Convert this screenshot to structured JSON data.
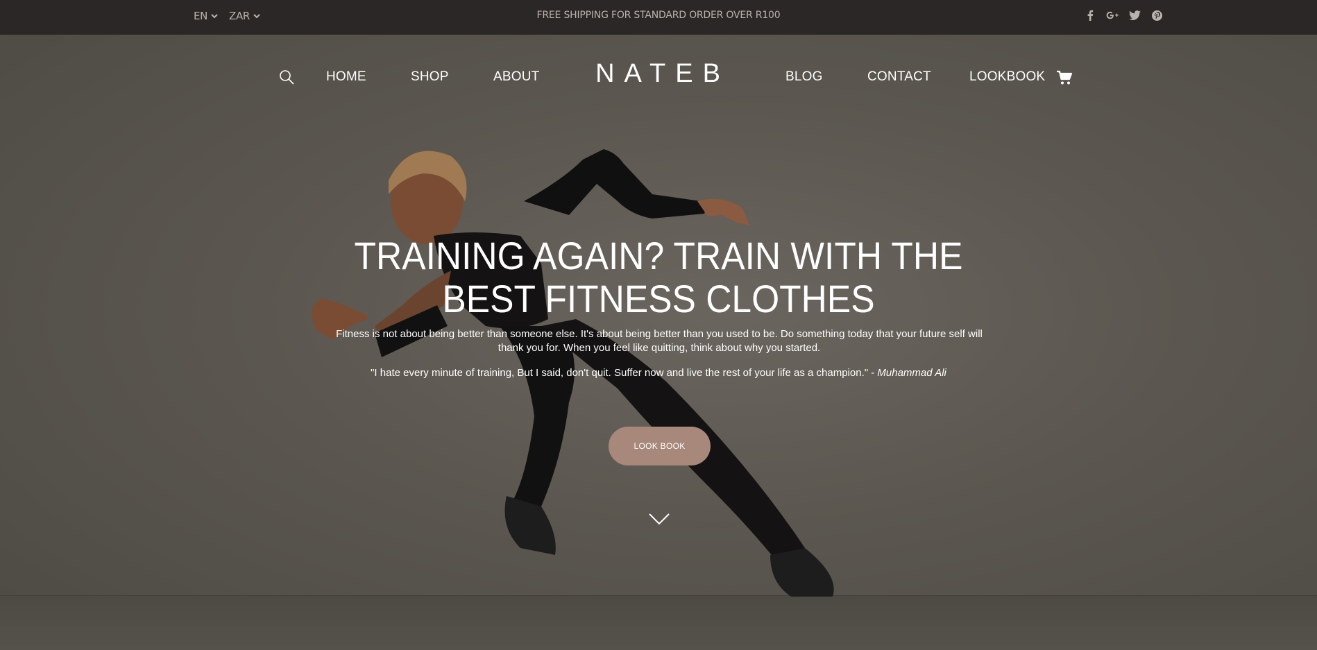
{
  "topbar": {
    "language": "EN",
    "currency": "ZAR",
    "promo": "FREE SHIPPING FOR STANDARD ORDER OVER R100",
    "social_icons": [
      "facebook-icon",
      "google-plus-icon",
      "twitter-icon",
      "pinterest-icon"
    ]
  },
  "nav": {
    "left": [
      "HOME",
      "SHOP",
      "ABOUT"
    ],
    "logo": "NATEB",
    "right": [
      "BLOG",
      "CONTACT",
      "LOOKBOOK"
    ]
  },
  "hero": {
    "headline_line1": "TRAINING AGAIN? TRAIN WITH THE",
    "headline_line2": "BEST FITNESS CLOTHES",
    "description": "Fitness is not about being better than someone else. It's about being better than you used to be. Do something today that your future self will thank you for. When you feel like quitting, think about why you started.",
    "quote": "\"I hate every minute of training, But I said, don't quit. Suffer now and live the rest of your life as a champion.\" - ",
    "quote_author": "Muhammad Ali",
    "cta_label": "LOOK BOOK"
  },
  "colors": {
    "topbar_bg": "#2c2727",
    "cta_bg": "#a7887a",
    "muted_text": "#b9b3ad"
  }
}
